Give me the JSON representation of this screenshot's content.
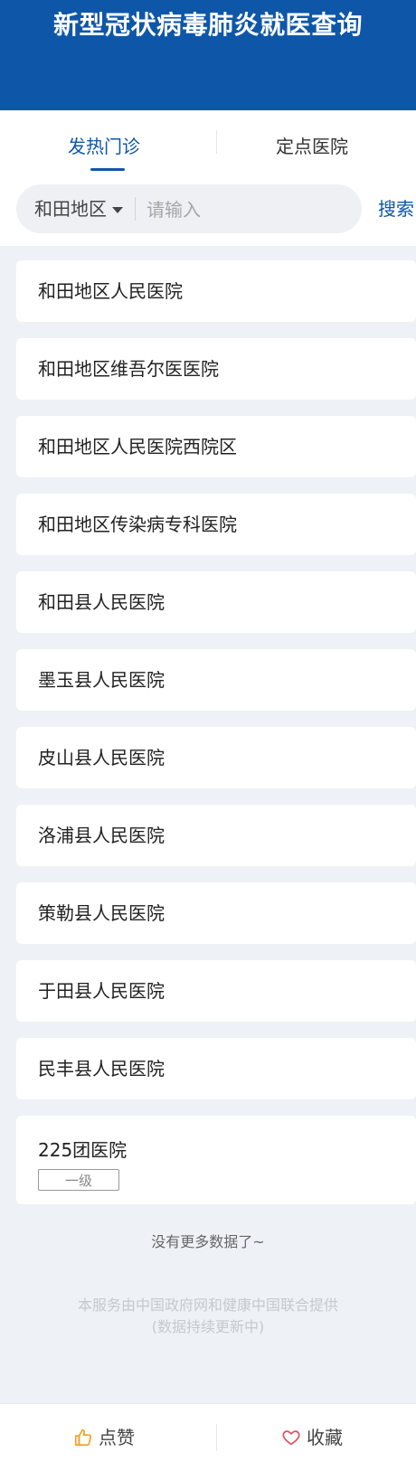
{
  "header": {
    "title": "新型冠状病毒肺炎就医查询"
  },
  "tabs": [
    {
      "label": "发热门诊",
      "active": true
    },
    {
      "label": "定点医院",
      "active": false
    }
  ],
  "search": {
    "region": "和田地区",
    "placeholder": "请输入",
    "value": "",
    "button_label": "搜索"
  },
  "hospitals": [
    {
      "name": "和田地区人民医院"
    },
    {
      "name": "和田地区维吾尔医医院"
    },
    {
      "name": "和田地区人民医院西院区"
    },
    {
      "name": "和田地区传染病专科医院"
    },
    {
      "name": "和田县人民医院"
    },
    {
      "name": "墨玉县人民医院"
    },
    {
      "name": "皮山县人民医院"
    },
    {
      "name": "洛浦县人民医院"
    },
    {
      "name": "策勒县人民医院"
    },
    {
      "name": "于田县人民医院"
    },
    {
      "name": "民丰县人民医院"
    },
    {
      "name": "225团医院",
      "badge": "一级"
    }
  ],
  "status": {
    "no_more": "没有更多数据了~"
  },
  "footer": {
    "line1": "本服务由中国政府网和健康中国联合提供",
    "line2": "(数据持续更新中)"
  },
  "bottom_bar": {
    "like_label": "点赞",
    "like_icon": "thumbs-up-icon",
    "favorite_label": "收藏",
    "favorite_icon": "heart-icon",
    "like_color": "#f0a020",
    "favorite_color": "#e0505a"
  },
  "colors": {
    "brand": "#0e57a8",
    "background": "#eef2f6"
  }
}
